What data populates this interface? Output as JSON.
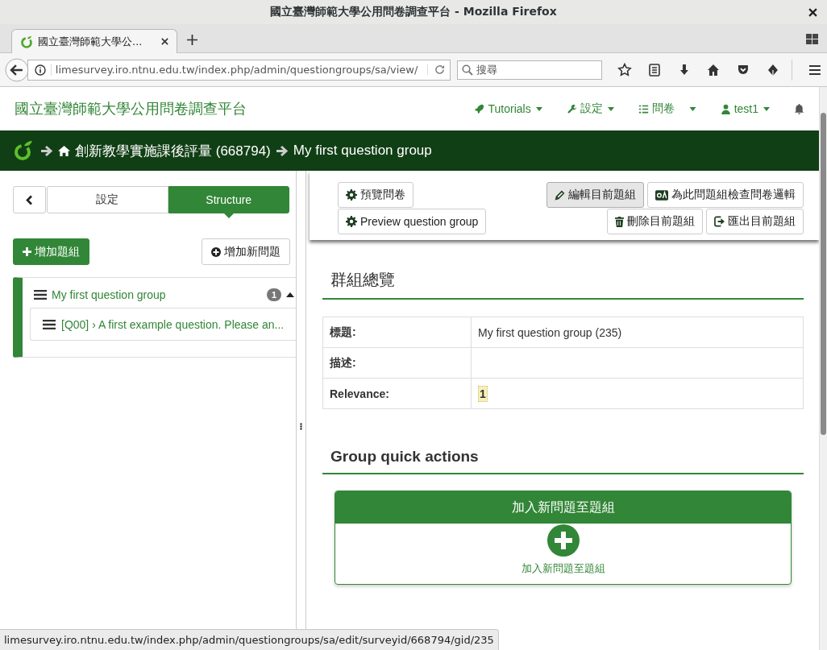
{
  "window": {
    "title": "國立臺灣師範大學公用問卷調查平台 - Mozilla Firefox"
  },
  "browser": {
    "tabs": [
      {
        "label": "國立臺灣師範大學公...",
        "selected": true
      }
    ],
    "url": "limesurvey.iro.ntnu.edu.tw/index.php/admin/questiongroups/sa/view/",
    "search": {
      "placeholder": "搜尋"
    }
  },
  "app": {
    "brand": "國立臺灣師範大學公用問卷調查平台",
    "menu": [
      {
        "label": "Tutorials",
        "kind": "tutorials"
      },
      {
        "label": "設定",
        "kind": "settings"
      },
      {
        "label": "問卷",
        "kind": "surveys"
      },
      {
        "label": "test1",
        "kind": "user"
      }
    ]
  },
  "breadcrumb": [
    {
      "label": "創新教學實施課後評量 (668794)",
      "kind": "home"
    },
    {
      "label": "My first question group",
      "kind": "current"
    }
  ],
  "sidebar": {
    "tabs": [
      {
        "label": "設定",
        "selected": false
      },
      {
        "label": "Structure",
        "selected": true
      }
    ],
    "add_group": "增加題組",
    "add_question": "增加新問題",
    "tree": [
      {
        "label": "My first question group",
        "count": "1",
        "expanded": true,
        "children": [
          {
            "label": "[Q00] › A first example question. Please an..."
          }
        ]
      }
    ]
  },
  "toolbar": {
    "left": [
      {
        "label": "預覽問卷",
        "kind": "gear",
        "hovered": false
      },
      {
        "label": "Preview question group",
        "kind": "gear",
        "hovered": false
      }
    ],
    "right": [
      {
        "label": "編輯目前題組",
        "kind": "pencil",
        "hovered": true
      },
      {
        "label": "為此問題組檢查問卷邏輯",
        "kind": "qa",
        "hovered": false
      },
      {
        "label": "刪除目前題組",
        "kind": "trash",
        "hovered": false
      },
      {
        "label": "匯出目前題組",
        "kind": "export",
        "hovered": false
      }
    ]
  },
  "overview": {
    "title": "群組總覽",
    "rows": [
      {
        "label": "標題:",
        "value": "My first question group (235)"
      },
      {
        "label": "描述:"
      },
      {
        "label": "Relevance:",
        "value": "1",
        "highlight": true
      }
    ]
  },
  "quick_actions": {
    "title": "Group quick actions",
    "card": {
      "header": "加入新問題至題組",
      "link": "加入新問題至題組"
    }
  },
  "status_bar": "limesurvey.iro.ntnu.edu.tw/index.php/admin/questiongroups/sa/edit/surveyid/668794/gid/235"
}
